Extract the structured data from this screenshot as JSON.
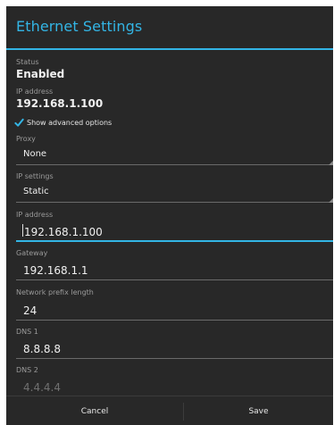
{
  "dialog": {
    "title": "Ethernet Settings"
  },
  "status": {
    "label": "Status",
    "value": "Enabled"
  },
  "ip_info": {
    "label": "IP address",
    "value": "192.168.1.100"
  },
  "advanced_options": {
    "label": "Show advanced options",
    "checked": true
  },
  "proxy": {
    "label": "Proxy",
    "selected": "None"
  },
  "ip_settings": {
    "label": "IP settings",
    "selected": "Static"
  },
  "fields": {
    "ip_address": {
      "label": "IP address",
      "value": "192.168.1.100"
    },
    "gateway": {
      "label": "Gateway",
      "value": "192.168.1.1"
    },
    "prefix_length": {
      "label": "Network prefix length",
      "value": "24"
    },
    "dns1": {
      "label": "DNS 1",
      "value": "8.8.8.8"
    },
    "dns2": {
      "label": "DNS 2",
      "hint": "4.4.4.4"
    }
  },
  "buttons": {
    "cancel": "Cancel",
    "save": "Save"
  },
  "colors": {
    "accent": "#33b5e5",
    "background": "#282828"
  }
}
